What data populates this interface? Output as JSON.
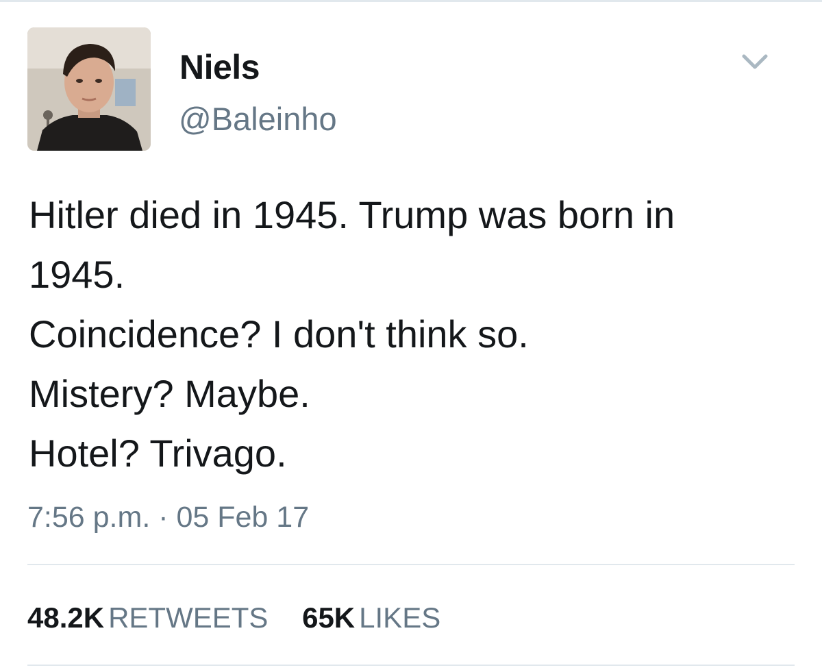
{
  "tweet": {
    "author": {
      "name": "Niels",
      "handle": "@Baleinho",
      "avatar_icon": "profile-photo"
    },
    "menu_icon": "chevron-down-icon",
    "text_lines": [
      "Hitler died in 1945. Trump was born in",
      "1945.",
      "Coincidence? I don't think so.",
      "Mistery? Maybe.",
      "Hotel? Trivago."
    ],
    "timestamp": "7:56 p.m. · 05 Feb 17",
    "stats": {
      "retweets_count": "48.2K",
      "retweets_label": "RETWEETS",
      "likes_count": "65K",
      "likes_label": "LIKES"
    }
  },
  "colors": {
    "text": "#14171a",
    "secondary": "#657786",
    "divider": "#e1e8ed",
    "background": "#ffffff"
  }
}
